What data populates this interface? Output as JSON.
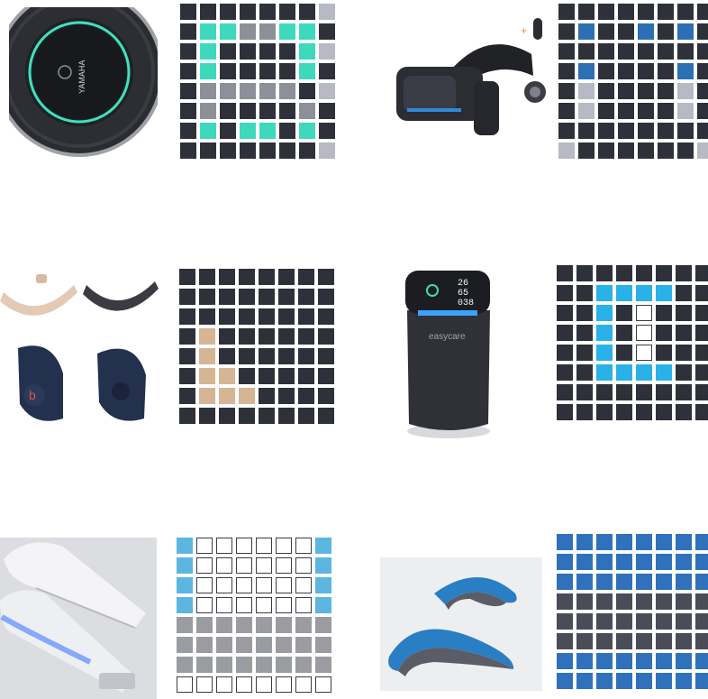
{
  "palette": {
    "D": "#2e3139",
    "W": "#ffffff",
    "T": "#3ed9bd",
    "G": "#8d9098",
    "L": "#b7bac4",
    "B": "#2d6fb3",
    "C": "#2ab2e8",
    "K": "#d6b594",
    "S": "#5db6e0",
    "N": "#9a9ca2",
    "U": "#2f72bb",
    "P": "#4a4d57"
  },
  "panels": [
    {
      "image": "yamaha-speakerphone-photo",
      "brand_text": "YAMAHA",
      "grid": [
        "DDDDDDDL",
        "DTTGGTTD",
        "DTDDDDTL",
        "DTDDDDTD",
        "DGGGGGDL",
        "DGDDDDGD",
        "DTDTTDTD",
        "DDDDDDDL"
      ]
    },
    {
      "image": "vr-headset-photo",
      "grid": [
        "DDDDDDDD",
        "DBDDBDBD",
        "DDDDDDDD",
        "DBDDDDBD",
        "DLDDDDLD",
        "DLDDDDLD",
        "DDDDDDDD",
        "LDDDDDDL"
      ]
    },
    {
      "image": "beats-earbuds-photo",
      "grid": [
        "DDDDDDDD",
        "DDDDDDDD",
        "DDDDDDDD",
        "DKDDDDDD",
        "DKDDDDDD",
        "DKKDDDDD",
        "DKKKDDDD",
        "DDDDDDDD"
      ]
    },
    {
      "image": "easycare-air-purifier-photo",
      "brand_text": "easycare",
      "display_values": [
        "26",
        "65",
        "038"
      ],
      "grid": [
        "DDDDDDDD",
        "DDCCCCDD",
        "DDCDWDDD",
        "DDCDWDDD",
        "DDCDWDDD",
        "DDCCCCDD",
        "DDDDDDDD",
        "DDDDDDDD"
      ]
    },
    {
      "image": "uv-sterilizer-wand-photo",
      "grid": [
        "SWWWWWWS",
        "SWWWWWWS",
        "SWWWWWWS",
        "SWWWWWWS",
        "NNNNNNNN",
        "NNNNNNNN",
        "NNNNNNNN",
        "WWWWWWWW"
      ]
    },
    {
      "image": "neck-massager-photo",
      "grid": [
        "UUUUUUUU",
        "UUUUUUUU",
        "UUUUUUUU",
        "PPPPPPPP",
        "PPPPPPPP",
        "PPPPPPPP",
        "UUUUUUUU",
        "UUUUUUUU"
      ]
    }
  ]
}
